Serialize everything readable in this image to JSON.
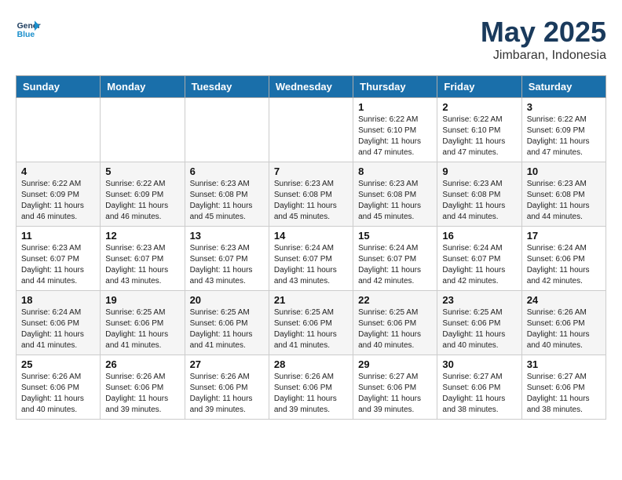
{
  "header": {
    "logo_line1": "General",
    "logo_line2": "Blue",
    "month": "May 2025",
    "location": "Jimbaran, Indonesia"
  },
  "weekdays": [
    "Sunday",
    "Monday",
    "Tuesday",
    "Wednesday",
    "Thursday",
    "Friday",
    "Saturday"
  ],
  "weeks": [
    [
      {
        "day": "",
        "info": ""
      },
      {
        "day": "",
        "info": ""
      },
      {
        "day": "",
        "info": ""
      },
      {
        "day": "",
        "info": ""
      },
      {
        "day": "1",
        "info": "Sunrise: 6:22 AM\nSunset: 6:10 PM\nDaylight: 11 hours\nand 47 minutes."
      },
      {
        "day": "2",
        "info": "Sunrise: 6:22 AM\nSunset: 6:10 PM\nDaylight: 11 hours\nand 47 minutes."
      },
      {
        "day": "3",
        "info": "Sunrise: 6:22 AM\nSunset: 6:09 PM\nDaylight: 11 hours\nand 47 minutes."
      }
    ],
    [
      {
        "day": "4",
        "info": "Sunrise: 6:22 AM\nSunset: 6:09 PM\nDaylight: 11 hours\nand 46 minutes."
      },
      {
        "day": "5",
        "info": "Sunrise: 6:22 AM\nSunset: 6:09 PM\nDaylight: 11 hours\nand 46 minutes."
      },
      {
        "day": "6",
        "info": "Sunrise: 6:23 AM\nSunset: 6:08 PM\nDaylight: 11 hours\nand 45 minutes."
      },
      {
        "day": "7",
        "info": "Sunrise: 6:23 AM\nSunset: 6:08 PM\nDaylight: 11 hours\nand 45 minutes."
      },
      {
        "day": "8",
        "info": "Sunrise: 6:23 AM\nSunset: 6:08 PM\nDaylight: 11 hours\nand 45 minutes."
      },
      {
        "day": "9",
        "info": "Sunrise: 6:23 AM\nSunset: 6:08 PM\nDaylight: 11 hours\nand 44 minutes."
      },
      {
        "day": "10",
        "info": "Sunrise: 6:23 AM\nSunset: 6:08 PM\nDaylight: 11 hours\nand 44 minutes."
      }
    ],
    [
      {
        "day": "11",
        "info": "Sunrise: 6:23 AM\nSunset: 6:07 PM\nDaylight: 11 hours\nand 44 minutes."
      },
      {
        "day": "12",
        "info": "Sunrise: 6:23 AM\nSunset: 6:07 PM\nDaylight: 11 hours\nand 43 minutes."
      },
      {
        "day": "13",
        "info": "Sunrise: 6:23 AM\nSunset: 6:07 PM\nDaylight: 11 hours\nand 43 minutes."
      },
      {
        "day": "14",
        "info": "Sunrise: 6:24 AM\nSunset: 6:07 PM\nDaylight: 11 hours\nand 43 minutes."
      },
      {
        "day": "15",
        "info": "Sunrise: 6:24 AM\nSunset: 6:07 PM\nDaylight: 11 hours\nand 42 minutes."
      },
      {
        "day": "16",
        "info": "Sunrise: 6:24 AM\nSunset: 6:07 PM\nDaylight: 11 hours\nand 42 minutes."
      },
      {
        "day": "17",
        "info": "Sunrise: 6:24 AM\nSunset: 6:06 PM\nDaylight: 11 hours\nand 42 minutes."
      }
    ],
    [
      {
        "day": "18",
        "info": "Sunrise: 6:24 AM\nSunset: 6:06 PM\nDaylight: 11 hours\nand 41 minutes."
      },
      {
        "day": "19",
        "info": "Sunrise: 6:25 AM\nSunset: 6:06 PM\nDaylight: 11 hours\nand 41 minutes."
      },
      {
        "day": "20",
        "info": "Sunrise: 6:25 AM\nSunset: 6:06 PM\nDaylight: 11 hours\nand 41 minutes."
      },
      {
        "day": "21",
        "info": "Sunrise: 6:25 AM\nSunset: 6:06 PM\nDaylight: 11 hours\nand 41 minutes."
      },
      {
        "day": "22",
        "info": "Sunrise: 6:25 AM\nSunset: 6:06 PM\nDaylight: 11 hours\nand 40 minutes."
      },
      {
        "day": "23",
        "info": "Sunrise: 6:25 AM\nSunset: 6:06 PM\nDaylight: 11 hours\nand 40 minutes."
      },
      {
        "day": "24",
        "info": "Sunrise: 6:26 AM\nSunset: 6:06 PM\nDaylight: 11 hours\nand 40 minutes."
      }
    ],
    [
      {
        "day": "25",
        "info": "Sunrise: 6:26 AM\nSunset: 6:06 PM\nDaylight: 11 hours\nand 40 minutes."
      },
      {
        "day": "26",
        "info": "Sunrise: 6:26 AM\nSunset: 6:06 PM\nDaylight: 11 hours\nand 39 minutes."
      },
      {
        "day": "27",
        "info": "Sunrise: 6:26 AM\nSunset: 6:06 PM\nDaylight: 11 hours\nand 39 minutes."
      },
      {
        "day": "28",
        "info": "Sunrise: 6:26 AM\nSunset: 6:06 PM\nDaylight: 11 hours\nand 39 minutes."
      },
      {
        "day": "29",
        "info": "Sunrise: 6:27 AM\nSunset: 6:06 PM\nDaylight: 11 hours\nand 39 minutes."
      },
      {
        "day": "30",
        "info": "Sunrise: 6:27 AM\nSunset: 6:06 PM\nDaylight: 11 hours\nand 38 minutes."
      },
      {
        "day": "31",
        "info": "Sunrise: 6:27 AM\nSunset: 6:06 PM\nDaylight: 11 hours\nand 38 minutes."
      }
    ]
  ]
}
